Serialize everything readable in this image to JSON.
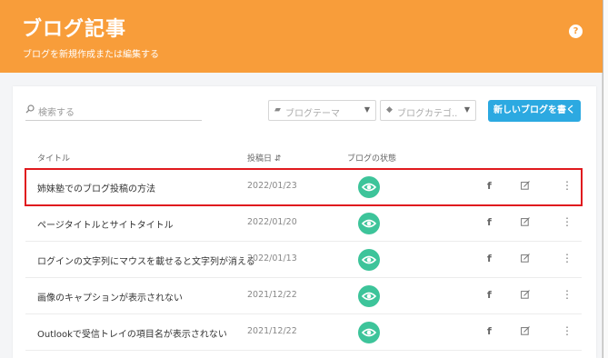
{
  "header": {
    "title": "ブログ記事",
    "subtitle": "ブログを新規作成または編集する",
    "help": "?"
  },
  "toolbar": {
    "search_placeholder": "検索する",
    "theme_select": "ブログテーマ",
    "category_select": "ブログカテゴ..",
    "new_button": "新しいブログを書く"
  },
  "table": {
    "columns": {
      "title": "タイトル",
      "date": "投稿日 ⇵",
      "status": "ブログの状態"
    },
    "rows": [
      {
        "title": "姉妹塾でのブログ投稿の方法",
        "date": "2022/01/23",
        "fb": "f"
      },
      {
        "title": "ページタイトルとサイトタイトル",
        "date": "2022/01/20",
        "fb": "f"
      },
      {
        "title": "ログインの文字列にマウスを載せると文字列が消える",
        "date": "2022/01/13",
        "fb": "f"
      },
      {
        "title": "画像のキャプションが表示されない",
        "date": "2021/12/22",
        "fb": "f"
      },
      {
        "title": "Outlookで受信トレイの項目名が表示されない",
        "date": "2021/12/22",
        "fb": "f"
      }
    ]
  },
  "colors": {
    "header": "#f89d3a",
    "button": "#2ca9e1",
    "status": "#3dc49a",
    "highlight": "#e0191e"
  },
  "icons": [
    "help-icon",
    "search-icon",
    "folder-icon",
    "tag-icon",
    "caret-down-icon",
    "eye-icon",
    "facebook-icon",
    "edit-icon",
    "more-vert-icon"
  ]
}
